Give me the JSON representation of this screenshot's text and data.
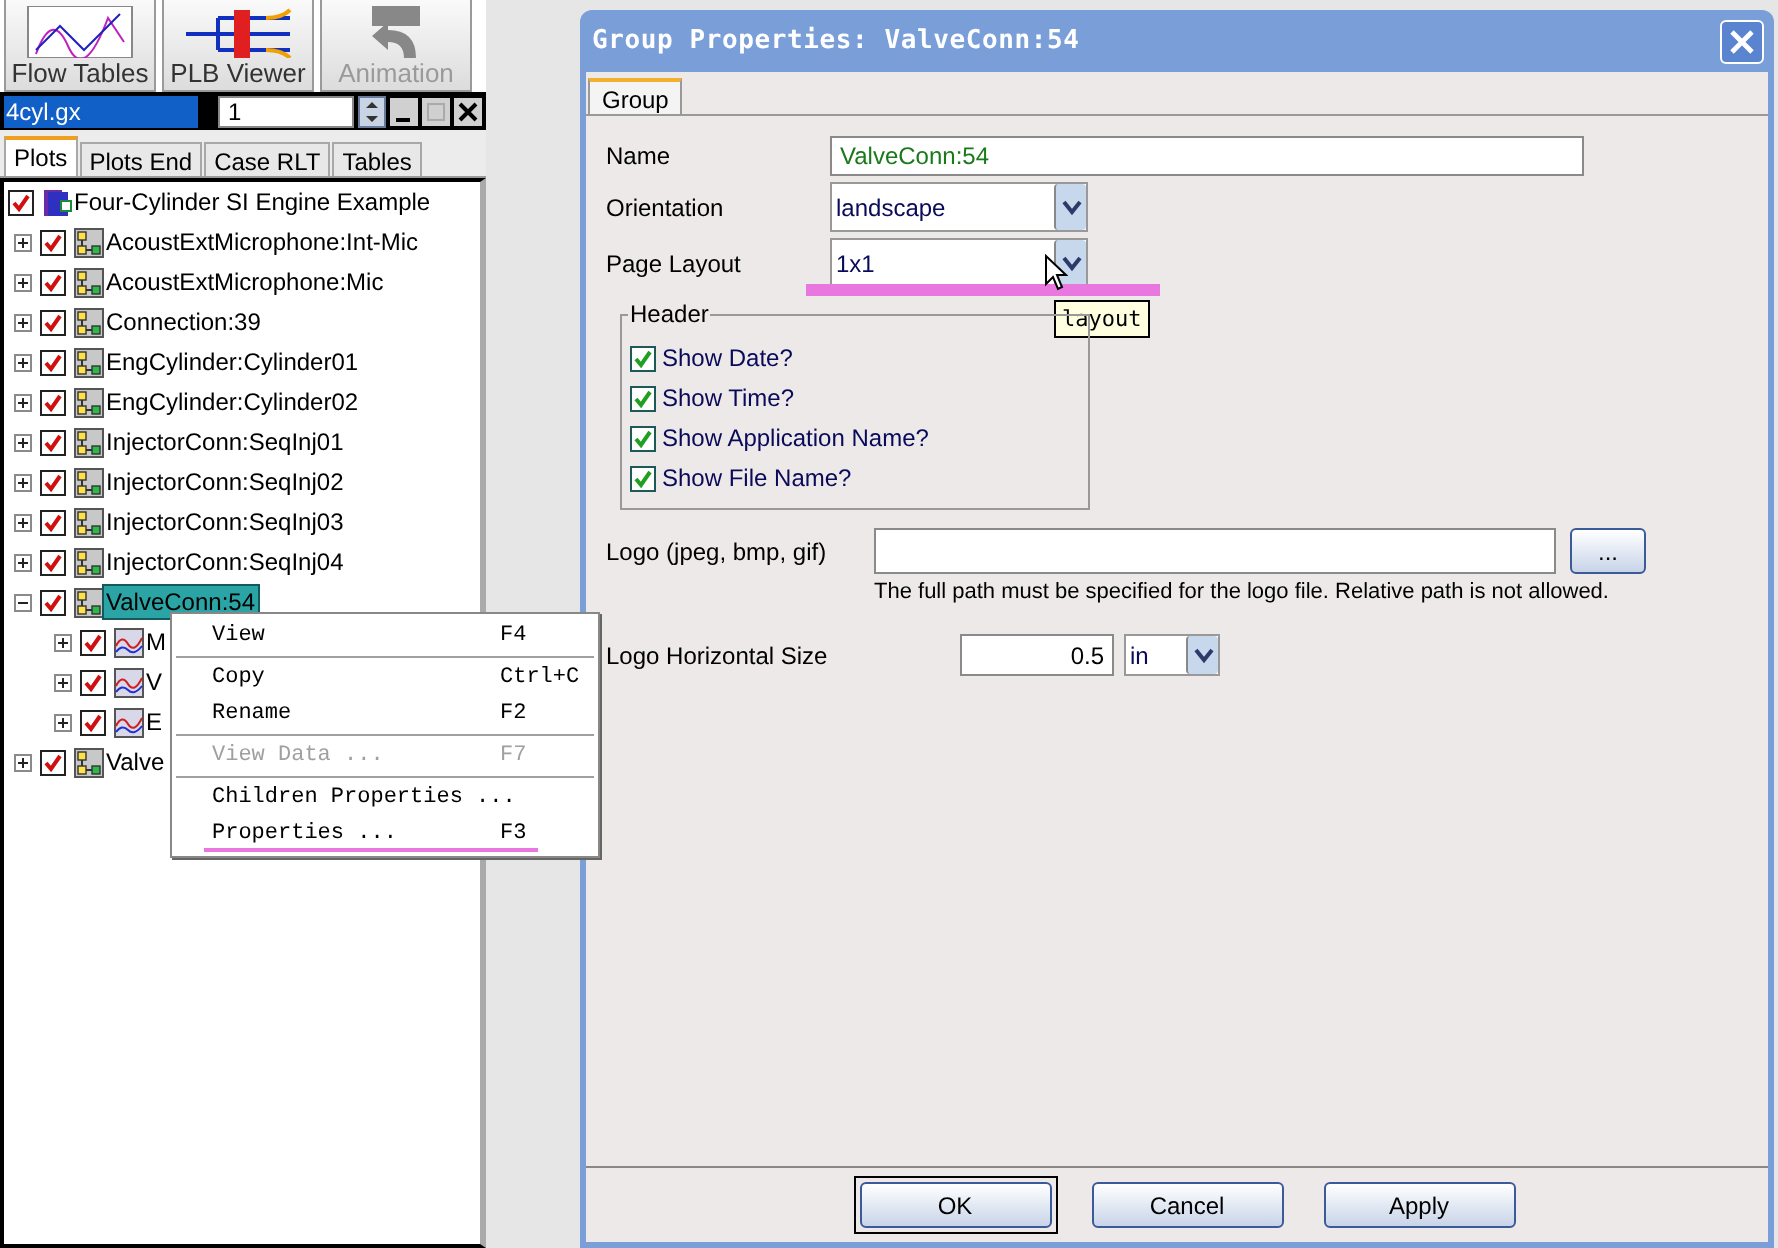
{
  "toolbar": [
    {
      "label": "Flow Tables",
      "kind": "chart",
      "disabled": false
    },
    {
      "label": "PLB Viewer",
      "kind": "diagram",
      "disabled": false
    },
    {
      "label": "Animation",
      "kind": "animation",
      "disabled": true
    }
  ],
  "document": {
    "title": "4cyl.gx",
    "spin_value": "1"
  },
  "tabs": [
    {
      "label": "Plots",
      "selected": true
    },
    {
      "label": "Plots End",
      "selected": false
    },
    {
      "label": "Case RLT",
      "selected": false
    },
    {
      "label": "Tables",
      "selected": false
    }
  ],
  "tree": {
    "label": "Four-Cylinder SI Engine Example",
    "kind": "root",
    "checked": true,
    "selected": false,
    "children": [
      {
        "label": "AcoustExtMicrophone:Int-Mic",
        "kind": "group",
        "checked": true,
        "selected": false,
        "expanded": false
      },
      {
        "label": "AcoustExtMicrophone:Mic",
        "kind": "group",
        "checked": true,
        "selected": false,
        "expanded": false
      },
      {
        "label": "Connection:39",
        "kind": "group",
        "checked": true,
        "selected": false,
        "expanded": false
      },
      {
        "label": "EngCylinder:Cylinder01",
        "kind": "group",
        "checked": true,
        "selected": false,
        "expanded": false
      },
      {
        "label": "EngCylinder:Cylinder02",
        "kind": "group",
        "checked": true,
        "selected": false,
        "expanded": false
      },
      {
        "label": "InjectorConn:SeqInj01",
        "kind": "group",
        "checked": true,
        "selected": false,
        "expanded": false
      },
      {
        "label": "InjectorConn:SeqInj02",
        "kind": "group",
        "checked": true,
        "selected": false,
        "expanded": false
      },
      {
        "label": "InjectorConn:SeqInj03",
        "kind": "group",
        "checked": true,
        "selected": false,
        "expanded": false
      },
      {
        "label": "InjectorConn:SeqInj04",
        "kind": "group",
        "checked": true,
        "selected": false,
        "expanded": false
      },
      {
        "label": "ValveConn:54",
        "kind": "group",
        "checked": true,
        "selected": true,
        "expanded": true,
        "children": [
          {
            "label": "M",
            "kind": "plot",
            "checked": true,
            "selected": false,
            "expanded": false
          },
          {
            "label": "V",
            "kind": "plot",
            "checked": true,
            "selected": false,
            "expanded": false
          },
          {
            "label": "E",
            "kind": "plot",
            "checked": true,
            "selected": false,
            "expanded": false
          }
        ]
      },
      {
        "label": "Valve",
        "kind": "group",
        "checked": true,
        "selected": false,
        "expanded": false
      }
    ]
  },
  "context_menu": [
    {
      "kind": "item",
      "label": "View",
      "shortcut": "F4",
      "disabled": false,
      "highlighted": false
    },
    {
      "kind": "separator"
    },
    {
      "kind": "item",
      "label": "Copy",
      "shortcut": "Ctrl+C",
      "disabled": false,
      "highlighted": false
    },
    {
      "kind": "item",
      "label": "Rename",
      "shortcut": "F2",
      "disabled": false,
      "highlighted": false
    },
    {
      "kind": "separator"
    },
    {
      "kind": "item",
      "label": "View Data ...",
      "shortcut": "F7",
      "disabled": true,
      "highlighted": false
    },
    {
      "kind": "separator"
    },
    {
      "kind": "item",
      "label": "Children Properties ...",
      "disabled": false,
      "highlighted": false
    },
    {
      "kind": "item",
      "label": "Properties ...",
      "shortcut": "F3",
      "disabled": false,
      "highlighted": true
    }
  ],
  "dialog": {
    "title": "Group Properties: ValveConn:54",
    "tabs": [
      {
        "label": "Group",
        "selected": true
      }
    ],
    "name": {
      "label": "Name",
      "value": "ValveConn:54"
    },
    "orientation": {
      "label": "Orientation",
      "value": "landscape"
    },
    "page_layout": {
      "label": "Page Layout",
      "value": "1x1",
      "highlighted": true,
      "tooltip": "layout"
    },
    "header": {
      "title": "Header",
      "options": [
        {
          "label": "Show Date?",
          "checked": true
        },
        {
          "label": "Show Time?",
          "checked": true
        },
        {
          "label": "Show Application Name?",
          "checked": true
        },
        {
          "label": "Show File Name?",
          "checked": true
        }
      ]
    },
    "logo": {
      "label": "Logo (jpeg, bmp, gif)",
      "browse": "...",
      "hint": "The full path must be specified for the logo file.  Relative path is not allowed."
    },
    "logo_size": {
      "label": "Logo Horizontal Size",
      "value": "0.5",
      "unit": "in"
    },
    "buttons": [
      {
        "label": "OK",
        "default": true
      },
      {
        "label": "Cancel",
        "default": false
      },
      {
        "label": "Apply",
        "default": false
      }
    ]
  }
}
